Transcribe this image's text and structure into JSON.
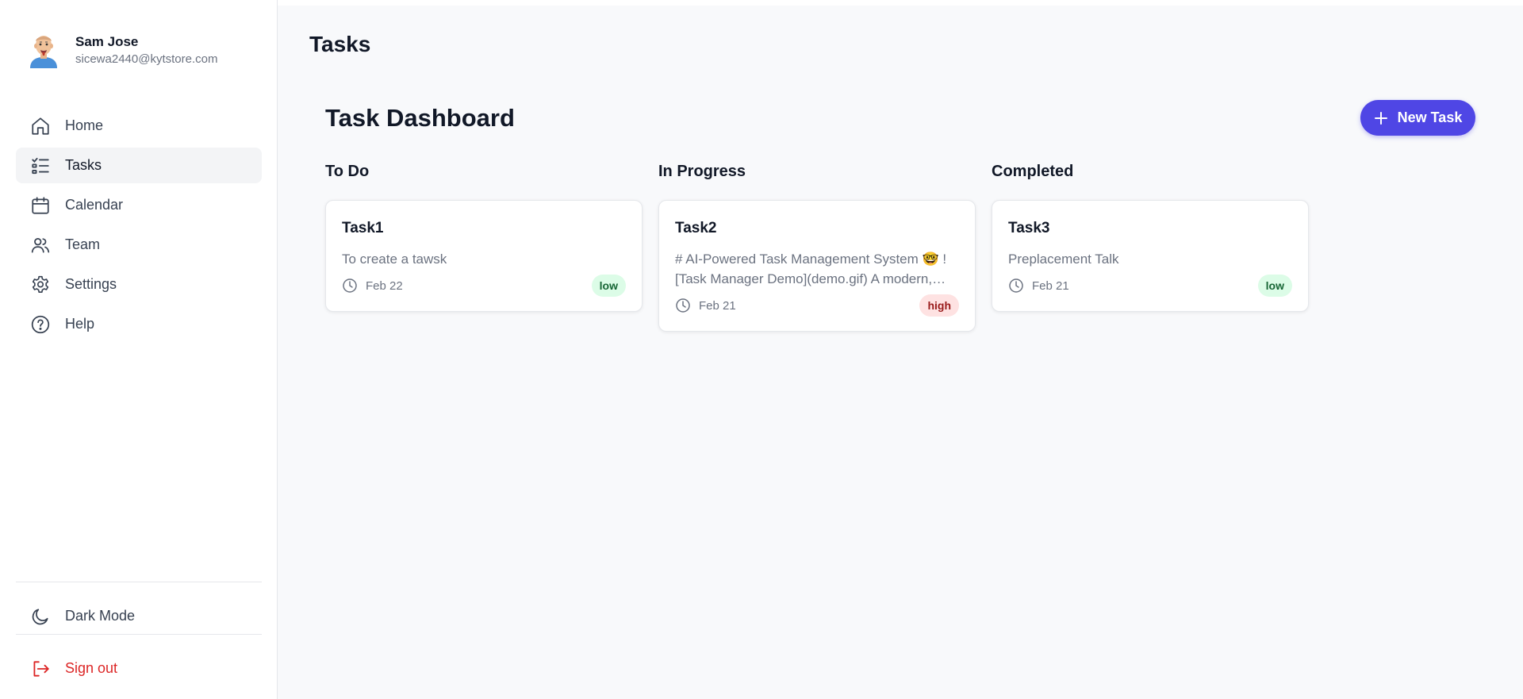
{
  "user": {
    "name": "Sam Jose",
    "email": "sicewa2440@kytstore.com"
  },
  "nav": [
    {
      "label": "Home",
      "icon": "home-icon",
      "active": false
    },
    {
      "label": "Tasks",
      "icon": "tasks-list-icon",
      "active": true
    },
    {
      "label": "Calendar",
      "icon": "calendar-icon",
      "active": false
    },
    {
      "label": "Team",
      "icon": "team-icon",
      "active": false
    },
    {
      "label": "Settings",
      "icon": "gear-icon",
      "active": false
    },
    {
      "label": "Help",
      "icon": "help-icon",
      "active": false
    }
  ],
  "bottom": {
    "dark_mode": "Dark Mode",
    "sign_out": "Sign out"
  },
  "page_title": "Tasks",
  "dashboard": {
    "title": "Task Dashboard",
    "new_task_label": "New Task",
    "columns": [
      {
        "title": "To Do",
        "cards": [
          {
            "title": "Task1",
            "description": "To create a tawsk",
            "date": "Feb 22",
            "priority": "low"
          }
        ]
      },
      {
        "title": "In Progress",
        "cards": [
          {
            "title": "Task2",
            "description": "# AI-Powered Task Management System 🤓 ![Task Manager Demo](demo.gif) A modern, responsive task management system",
            "date": "Feb 21",
            "priority": "high"
          }
        ]
      },
      {
        "title": "Completed",
        "cards": [
          {
            "title": "Task3",
            "description": "Preplacement Talk",
            "date": "Feb 21",
            "priority": "low"
          }
        ]
      }
    ]
  },
  "colors": {
    "accent": "#4f46e5",
    "low_bg": "#dcfce7",
    "high_bg": "#fee2e2",
    "sign_out": "#dc2626"
  }
}
